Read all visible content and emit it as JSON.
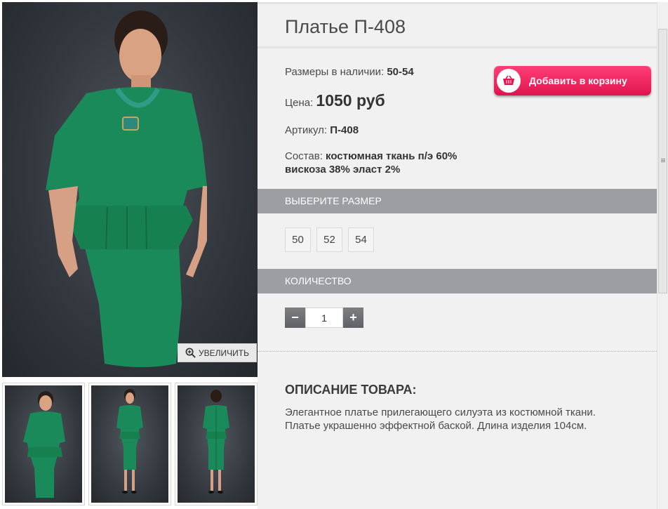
{
  "product": {
    "title": "Платье П-408",
    "sizes_label": "Размеры в наличии:",
    "sizes_value": "50-54",
    "price_label": "Цена:",
    "price_value": "1050 руб",
    "article_label": "Артикул:",
    "article_value": "П-408",
    "composition_label": "Состав:",
    "composition_value_1": "костюмная ткань п/э 60%",
    "composition_value_2": "вискоза 38% эласт 2%"
  },
  "cart_button": {
    "label": "Добавить в корзину",
    "icon": "basket-icon",
    "color": "#e8195a"
  },
  "gallery": {
    "zoom_label": "УВЕЛИЧИТЬ",
    "zoom_icon": "magnifier-plus-icon",
    "dress_color": "#1b8a5a"
  },
  "size_section": {
    "header": "ВЫБЕРИТЕ РАЗМЕР",
    "options": [
      "50",
      "52",
      "54"
    ]
  },
  "quantity_section": {
    "header": "КОЛИЧЕСТВО",
    "minus": "−",
    "plus": "+",
    "value": "1"
  },
  "description": {
    "title": "ОПИСАНИЕ ТОВАРА:",
    "line_1": "Элегантное платье прилегающего силуэта из костюмной ткани.",
    "line_2": "Платье украшенно эффектной баской. Длина изделия 104см."
  }
}
